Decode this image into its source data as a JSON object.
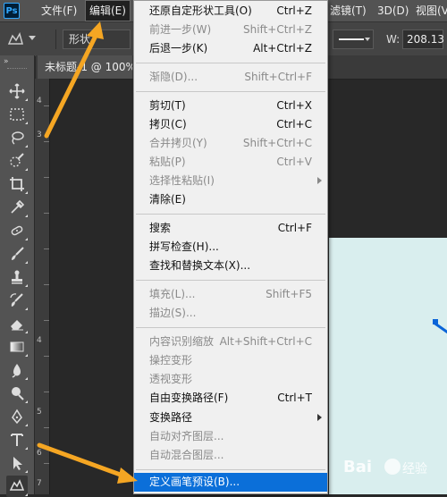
{
  "menubar": {
    "logo": "Ps",
    "items": [
      "文件(F)",
      "编辑(E)",
      "滤镜(T)",
      "3D(D)",
      "视图(V)"
    ],
    "active_index": 1
  },
  "optbar": {
    "mode_label": "形状",
    "width_label": "W:",
    "width_value": "208.13"
  },
  "document": {
    "tab_title": "未标题-1 @ 100%"
  },
  "ruler": {
    "numbers": [
      "4",
      "3",
      "4",
      "5",
      "6",
      "7"
    ]
  },
  "edit_menu": {
    "items": [
      {
        "label": "还原自定形状工具(O)",
        "shortcut": "Ctrl+Z",
        "disabled": false
      },
      {
        "label": "前进一步(W)",
        "shortcut": "Shift+Ctrl+Z",
        "disabled": true
      },
      {
        "label": "后退一步(K)",
        "shortcut": "Alt+Ctrl+Z",
        "disabled": false
      },
      {
        "label": "渐隐(D)...",
        "shortcut": "Shift+Ctrl+F",
        "disabled": true
      },
      {
        "label": "剪切(T)",
        "shortcut": "Ctrl+X",
        "disabled": false
      },
      {
        "label": "拷贝(C)",
        "shortcut": "Ctrl+C",
        "disabled": false
      },
      {
        "label": "合并拷贝(Y)",
        "shortcut": "Shift+Ctrl+C",
        "disabled": true
      },
      {
        "label": "粘贴(P)",
        "shortcut": "Ctrl+V",
        "disabled": true
      },
      {
        "label": "选择性粘贴(I)",
        "shortcut": "",
        "disabled": true,
        "submenu": true
      },
      {
        "label": "清除(E)",
        "shortcut": "",
        "disabled": false
      },
      {
        "label": "搜索",
        "shortcut": "Ctrl+F",
        "disabled": false
      },
      {
        "label": "拼写检查(H)...",
        "shortcut": "",
        "disabled": false
      },
      {
        "label": "查找和替换文本(X)...",
        "shortcut": "",
        "disabled": false
      },
      {
        "label": "填充(L)...",
        "shortcut": "Shift+F5",
        "disabled": true
      },
      {
        "label": "描边(S)...",
        "shortcut": "",
        "disabled": true
      },
      {
        "label": "内容识别缩放",
        "shortcut": "Alt+Shift+Ctrl+C",
        "disabled": true
      },
      {
        "label": "操控变形",
        "shortcut": "",
        "disabled": true
      },
      {
        "label": "透视变形",
        "shortcut": "",
        "disabled": true
      },
      {
        "label": "自由变换路径(F)",
        "shortcut": "Ctrl+T",
        "disabled": false
      },
      {
        "label": "变换路径",
        "shortcut": "",
        "disabled": false,
        "submenu": true
      },
      {
        "label": "自动对齐图层...",
        "shortcut": "",
        "disabled": true
      },
      {
        "label": "自动混合图层...",
        "shortcut": "",
        "disabled": true
      },
      {
        "label": "定义画笔预设(B)...",
        "shortcut": "",
        "disabled": false,
        "highlighted": true
      }
    ]
  },
  "toolbar": {
    "tools": [
      "move-icon",
      "marquee-icon",
      "lasso-icon",
      "quick-select-icon",
      "crop-icon",
      "eyedropper-icon",
      "healing-icon",
      "brush-icon",
      "stamp-icon",
      "history-brush-icon",
      "eraser-icon",
      "gradient-icon",
      "blur-icon",
      "dodge-icon",
      "pen-icon",
      "type-icon",
      "path-select-icon",
      "custom-shape-icon"
    ],
    "active_tool": "custom-shape-icon"
  },
  "watermark": {
    "text": "Bai",
    "text2": "经验"
  },
  "colors": {
    "menu_highlight": "#0b6fd9",
    "annotation_arrow": "#f5a623",
    "canvas": "#d9eeee"
  }
}
